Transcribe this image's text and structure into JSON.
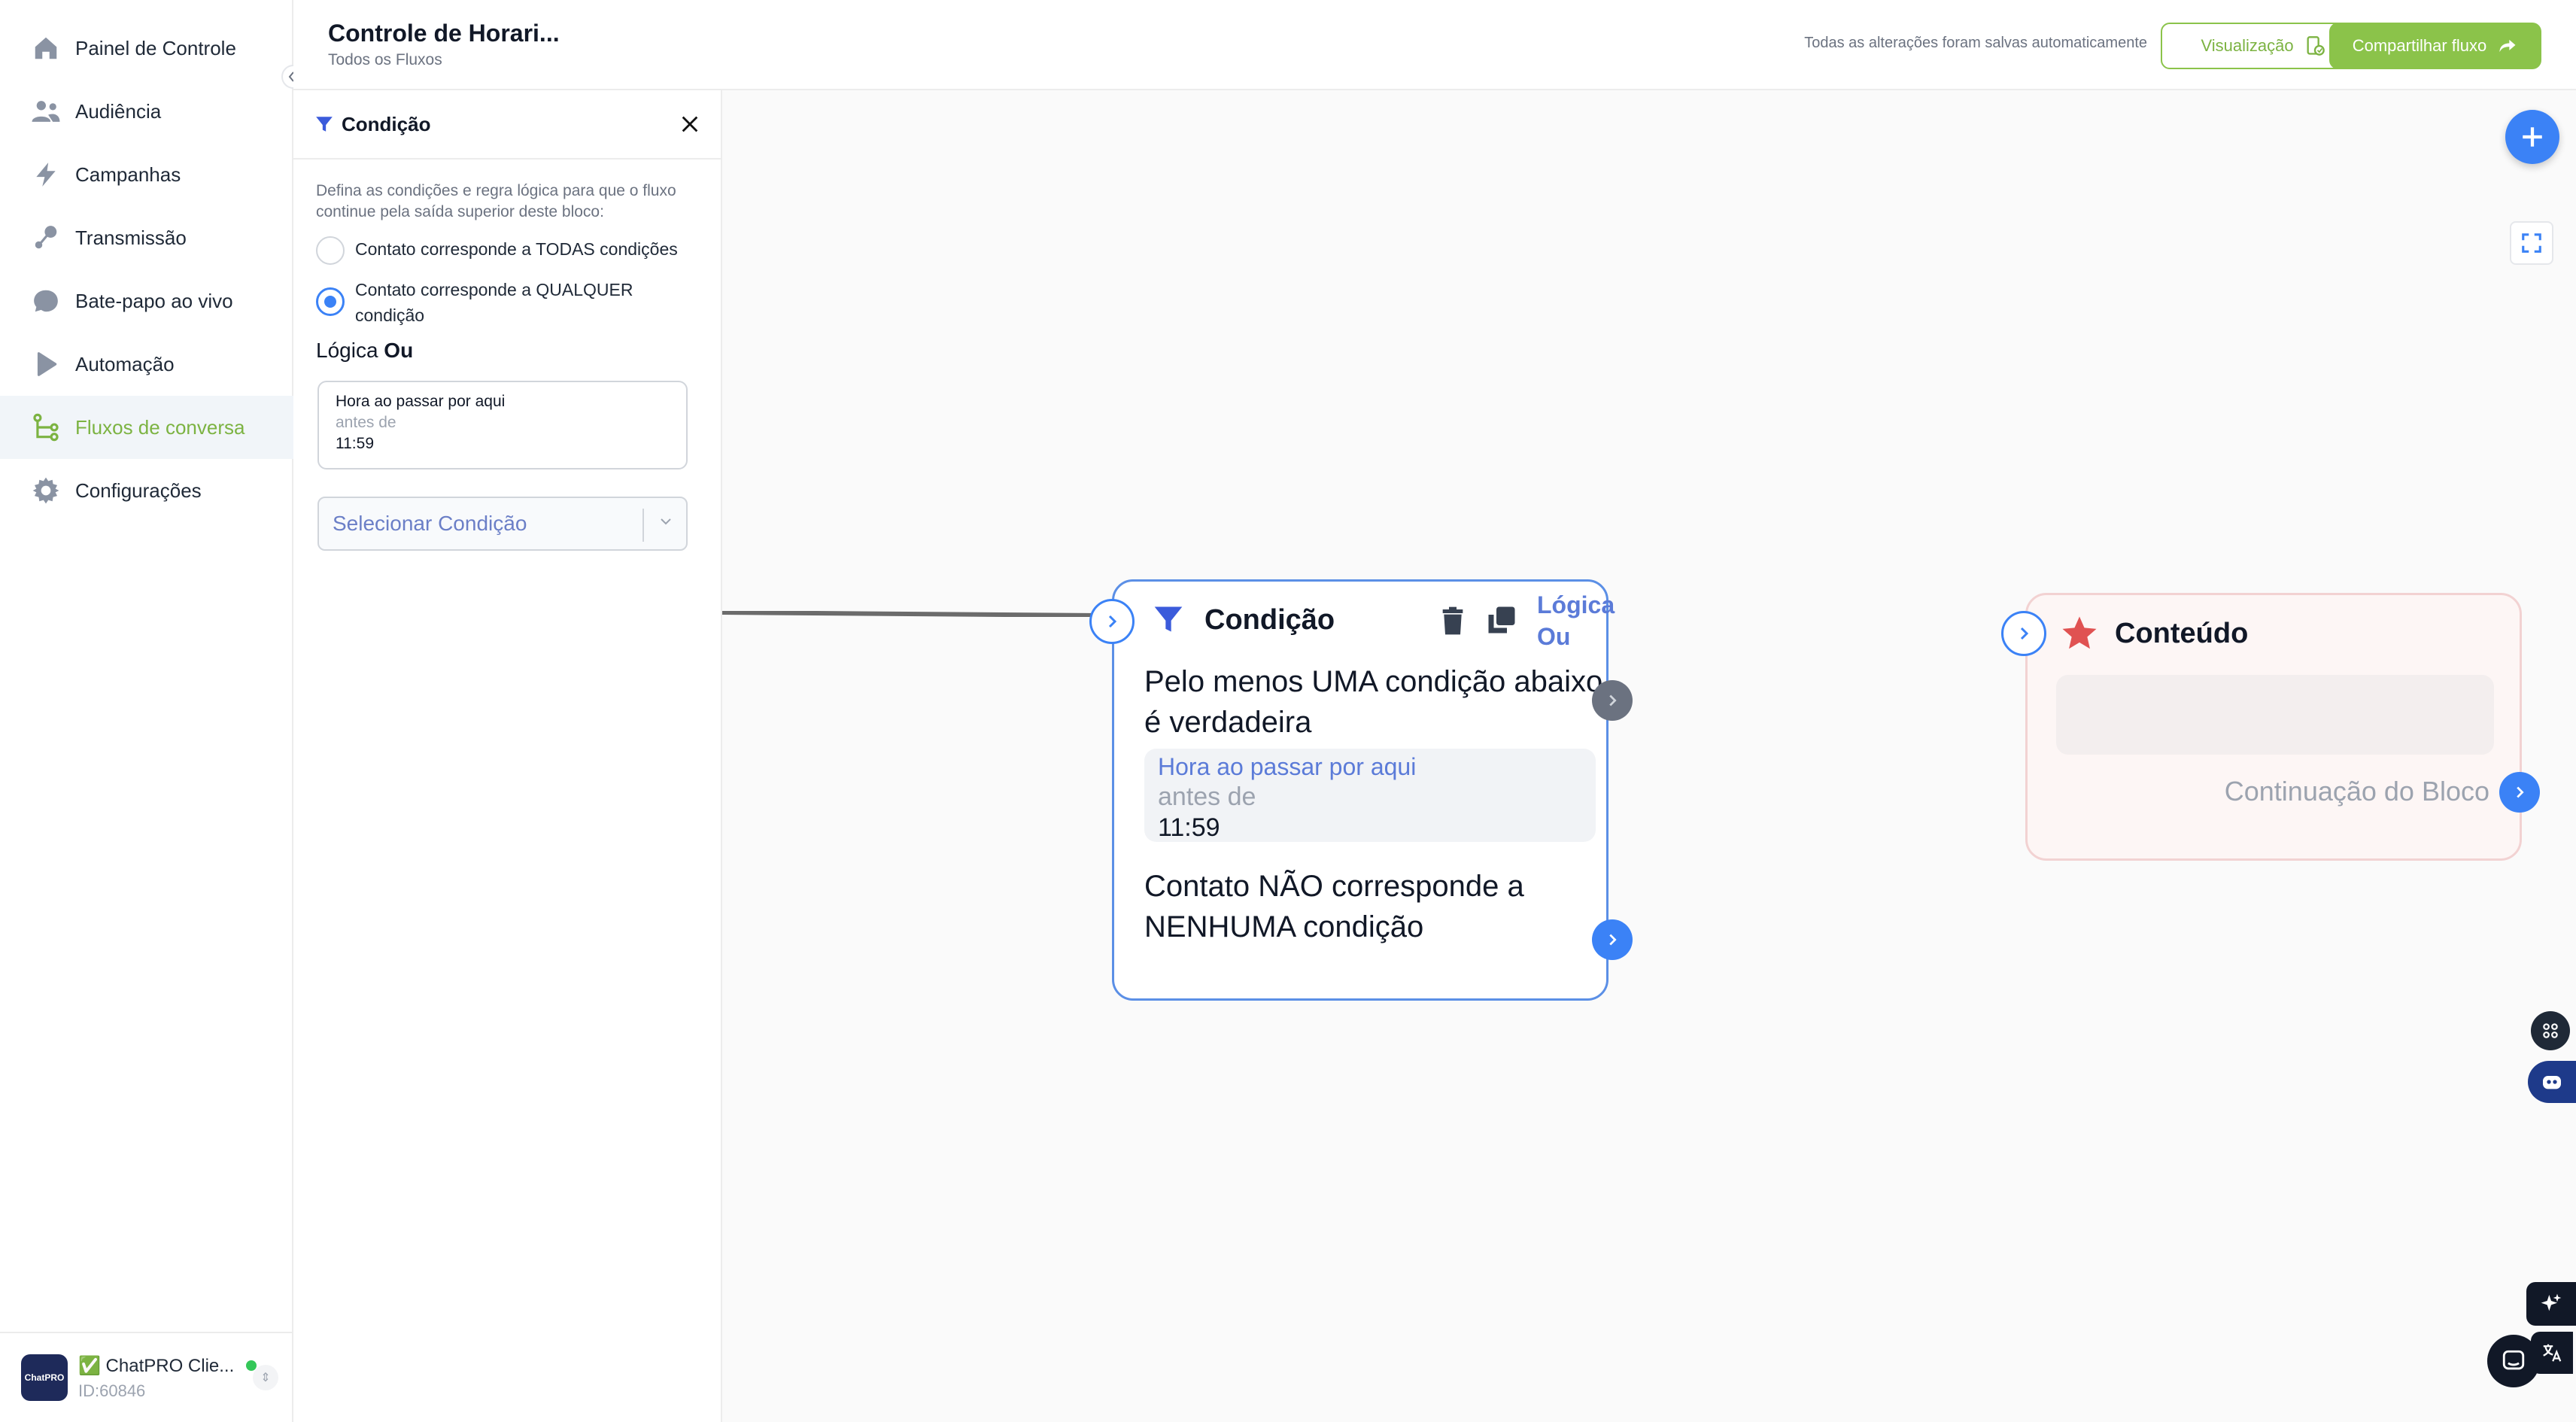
{
  "sidebar": {
    "items": [
      {
        "label": "Painel de Controle",
        "icon": "home-icon"
      },
      {
        "label": "Audiência",
        "icon": "users-icon"
      },
      {
        "label": "Campanhas",
        "icon": "lightning-icon"
      },
      {
        "label": "Transmissão",
        "icon": "broadcast-icon"
      },
      {
        "label": "Bate-papo ao vivo",
        "icon": "chat-bubble-icon"
      },
      {
        "label": "Automação",
        "icon": "play-icon"
      },
      {
        "label": "Fluxos de conversa",
        "icon": "flow-branch-icon"
      },
      {
        "label": "Configurações",
        "icon": "gear-icon"
      }
    ],
    "active_index": 6,
    "user": {
      "name": "✅ ChatPRO Clie...",
      "id": "ID:60846",
      "logo_text": "ChatPRO"
    }
  },
  "header": {
    "title": "Controle de Horari...",
    "breadcrumb": "Todos os Fluxos",
    "save_status": "Todas as alterações foram salvas automaticamente",
    "preview_label": "Visualização",
    "share_label": "Compartilhar fluxo"
  },
  "panel": {
    "title": "Condição",
    "description": "Defina as condições e regra lógica para que o fluxo continue pela saída superior deste bloco:",
    "option_all": "Contato corresponde a TODAS condições",
    "option_any": "Contato corresponde a QUALQUER condição",
    "selected_option": "any",
    "logic_label": "Lógica",
    "logic_value": "Ou",
    "condition": {
      "title": "Hora ao passar por aqui",
      "operator": "antes de",
      "value": "11:59"
    },
    "select_placeholder": "Selecionar Condição"
  },
  "nodes": {
    "condition": {
      "title": "Condição",
      "logic_line1": "Lógica",
      "logic_line2": "Ou",
      "true_text": "Pelo menos UMA condição abaixo é verdadeira",
      "cond_title": "Hora ao passar por aqui",
      "cond_operator": "antes de",
      "cond_value": "11:59",
      "false_text": "Contato NÃO corresponde a NENHUMA condição"
    },
    "content": {
      "title": "Conteúdo",
      "continuation": "Continuação do Bloco"
    }
  },
  "colors": {
    "accent_green": "#8bc34a",
    "accent_blue": "#3b82f6",
    "node_border": "#5b8fe6",
    "star_red": "#e05252"
  }
}
